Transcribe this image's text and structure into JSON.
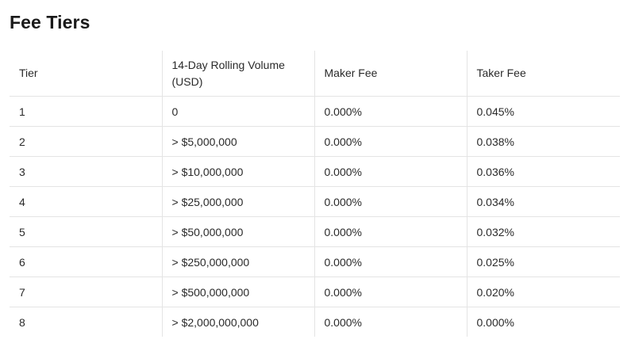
{
  "page": {
    "title": "Fee Tiers"
  },
  "table": {
    "headers": [
      "Tier",
      "14-Day Rolling Volume (USD)",
      "Maker Fee",
      "Taker Fee"
    ],
    "rows": [
      [
        "1",
        "0",
        "0.000%",
        "0.045%"
      ],
      [
        "2",
        "> $5,000,000",
        "0.000%",
        "0.038%"
      ],
      [
        "3",
        "> $10,000,000",
        "0.000%",
        "0.036%"
      ],
      [
        "4",
        "> $25,000,000",
        "0.000%",
        "0.034%"
      ],
      [
        "5",
        "> $50,000,000",
        "0.000%",
        "0.032%"
      ],
      [
        "6",
        "> $250,000,000",
        "0.000%",
        "0.025%"
      ],
      [
        "7",
        "> $500,000,000",
        "0.000%",
        "0.020%"
      ],
      [
        "8",
        "> $2,000,000,000",
        "0.000%",
        "0.000%"
      ]
    ]
  },
  "colors": {
    "text": "#2a2a2a",
    "title": "#1a1a1a",
    "border": "#e4e4e4"
  }
}
